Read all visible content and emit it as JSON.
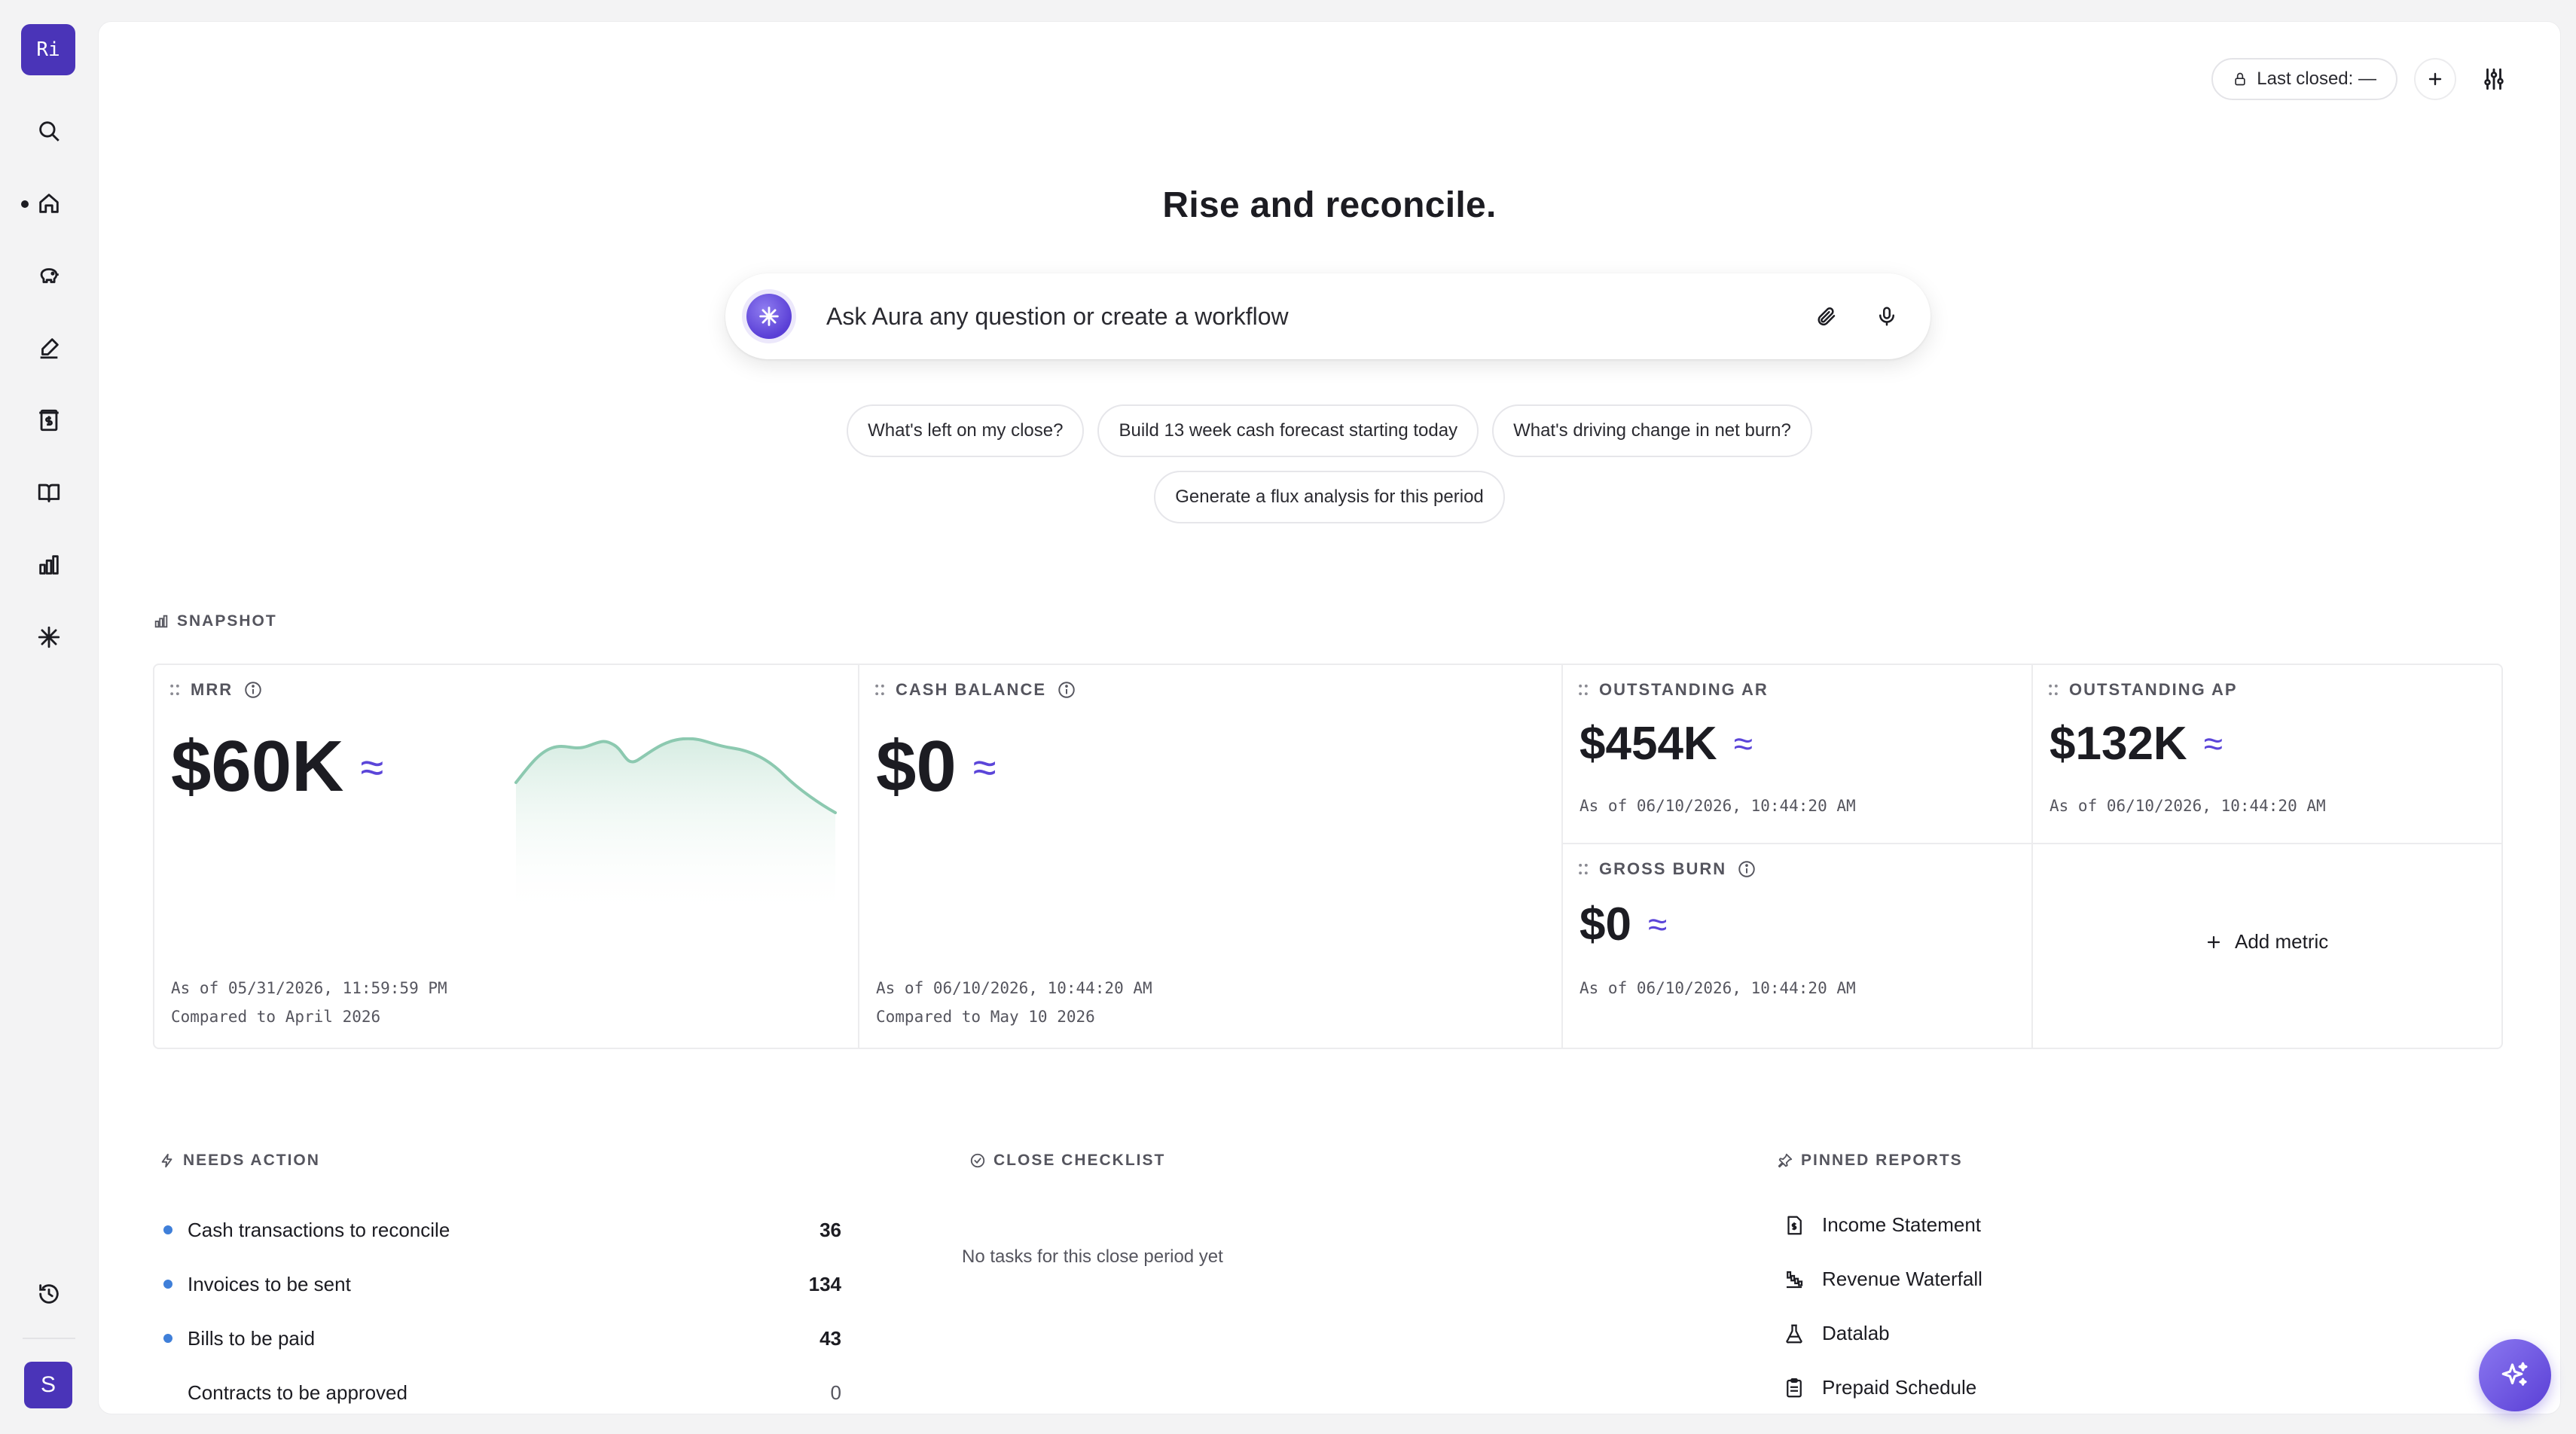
{
  "workspace": {
    "initials": "Ri"
  },
  "user": {
    "initial": "S"
  },
  "sidebar": {
    "items": [
      {
        "name": "search",
        "icon": "search-icon"
      },
      {
        "name": "home",
        "icon": "home-icon",
        "active": true
      },
      {
        "name": "savings",
        "icon": "piggy-bank-icon"
      },
      {
        "name": "contracts",
        "icon": "pen-sign-icon"
      },
      {
        "name": "receipts",
        "icon": "receipt-icon"
      },
      {
        "name": "ledger",
        "icon": "book-icon"
      },
      {
        "name": "reports",
        "icon": "bar-chart-icon"
      },
      {
        "name": "aura",
        "icon": "aura-sparkle-icon"
      }
    ],
    "history_icon": "history-icon"
  },
  "toolbar": {
    "last_closed_label": "Last closed: —",
    "add_icon": "plus-icon",
    "settings_icon": "sliders-icon"
  },
  "headline": "Rise and reconcile.",
  "ask": {
    "placeholder": "Ask Aura any question or create a workflow",
    "attach_icon": "paperclip-icon",
    "mic_icon": "microphone-icon"
  },
  "suggestions": {
    "row1": [
      "What's left on my close?",
      "Build 13 week cash forecast starting today",
      "What's driving change in net burn?"
    ],
    "row2": [
      "Generate a flux analysis for this period"
    ]
  },
  "snapshot": {
    "label": "SNAPSHOT",
    "mrr": {
      "title": "MRR",
      "value": "$60K",
      "approx": "≈",
      "as_of": "As of 05/31/2026, 11:59:59 PM",
      "compared": "Compared to April 2026"
    },
    "cash_balance": {
      "title": "CASH BALANCE",
      "value": "$0",
      "approx": "≈",
      "as_of": "As of 06/10/2026, 10:44:20 AM",
      "compared": "Compared to May 10 2026"
    },
    "outstanding_ar": {
      "title": "OUTSTANDING AR",
      "value": "$454K",
      "approx": "≈",
      "as_of": "As of 06/10/2026, 10:44:20 AM"
    },
    "outstanding_ap": {
      "title": "OUTSTANDING AP",
      "value": "$132K",
      "approx": "≈",
      "as_of": "As of 06/10/2026, 10:44:20 AM"
    },
    "gross_burn": {
      "title": "GROSS BURN",
      "value": "$0",
      "approx": "≈",
      "as_of": "As of 06/10/2026, 10:44:20 AM"
    },
    "add_metric_label": "Add metric"
  },
  "needs_action": {
    "label": "NEEDS ACTION",
    "rows": [
      {
        "label": "Cash transactions to reconcile",
        "count": "36",
        "dot": true
      },
      {
        "label": "Invoices to be sent",
        "count": "134",
        "dot": true
      },
      {
        "label": "Bills to be paid",
        "count": "43",
        "dot": true
      },
      {
        "label": "Contracts to be approved",
        "count": "0",
        "dot": false
      }
    ]
  },
  "close_checklist": {
    "label": "CLOSE CHECKLIST",
    "empty": "No tasks for this close period yet"
  },
  "pinned_reports": {
    "label": "PINNED REPORTS",
    "rows": [
      {
        "label": "Income Statement",
        "icon": "document-dollar-icon"
      },
      {
        "label": "Revenue Waterfall",
        "icon": "waterfall-icon"
      },
      {
        "label": "Datalab",
        "icon": "flask-icon"
      },
      {
        "label": "Prepaid Schedule",
        "icon": "clipboard-icon"
      }
    ]
  },
  "colors": {
    "accent": "#4a34b8",
    "approx": "#5b45d9",
    "sparkline": "#8cc9b0",
    "dot": "#3f7fd9"
  }
}
